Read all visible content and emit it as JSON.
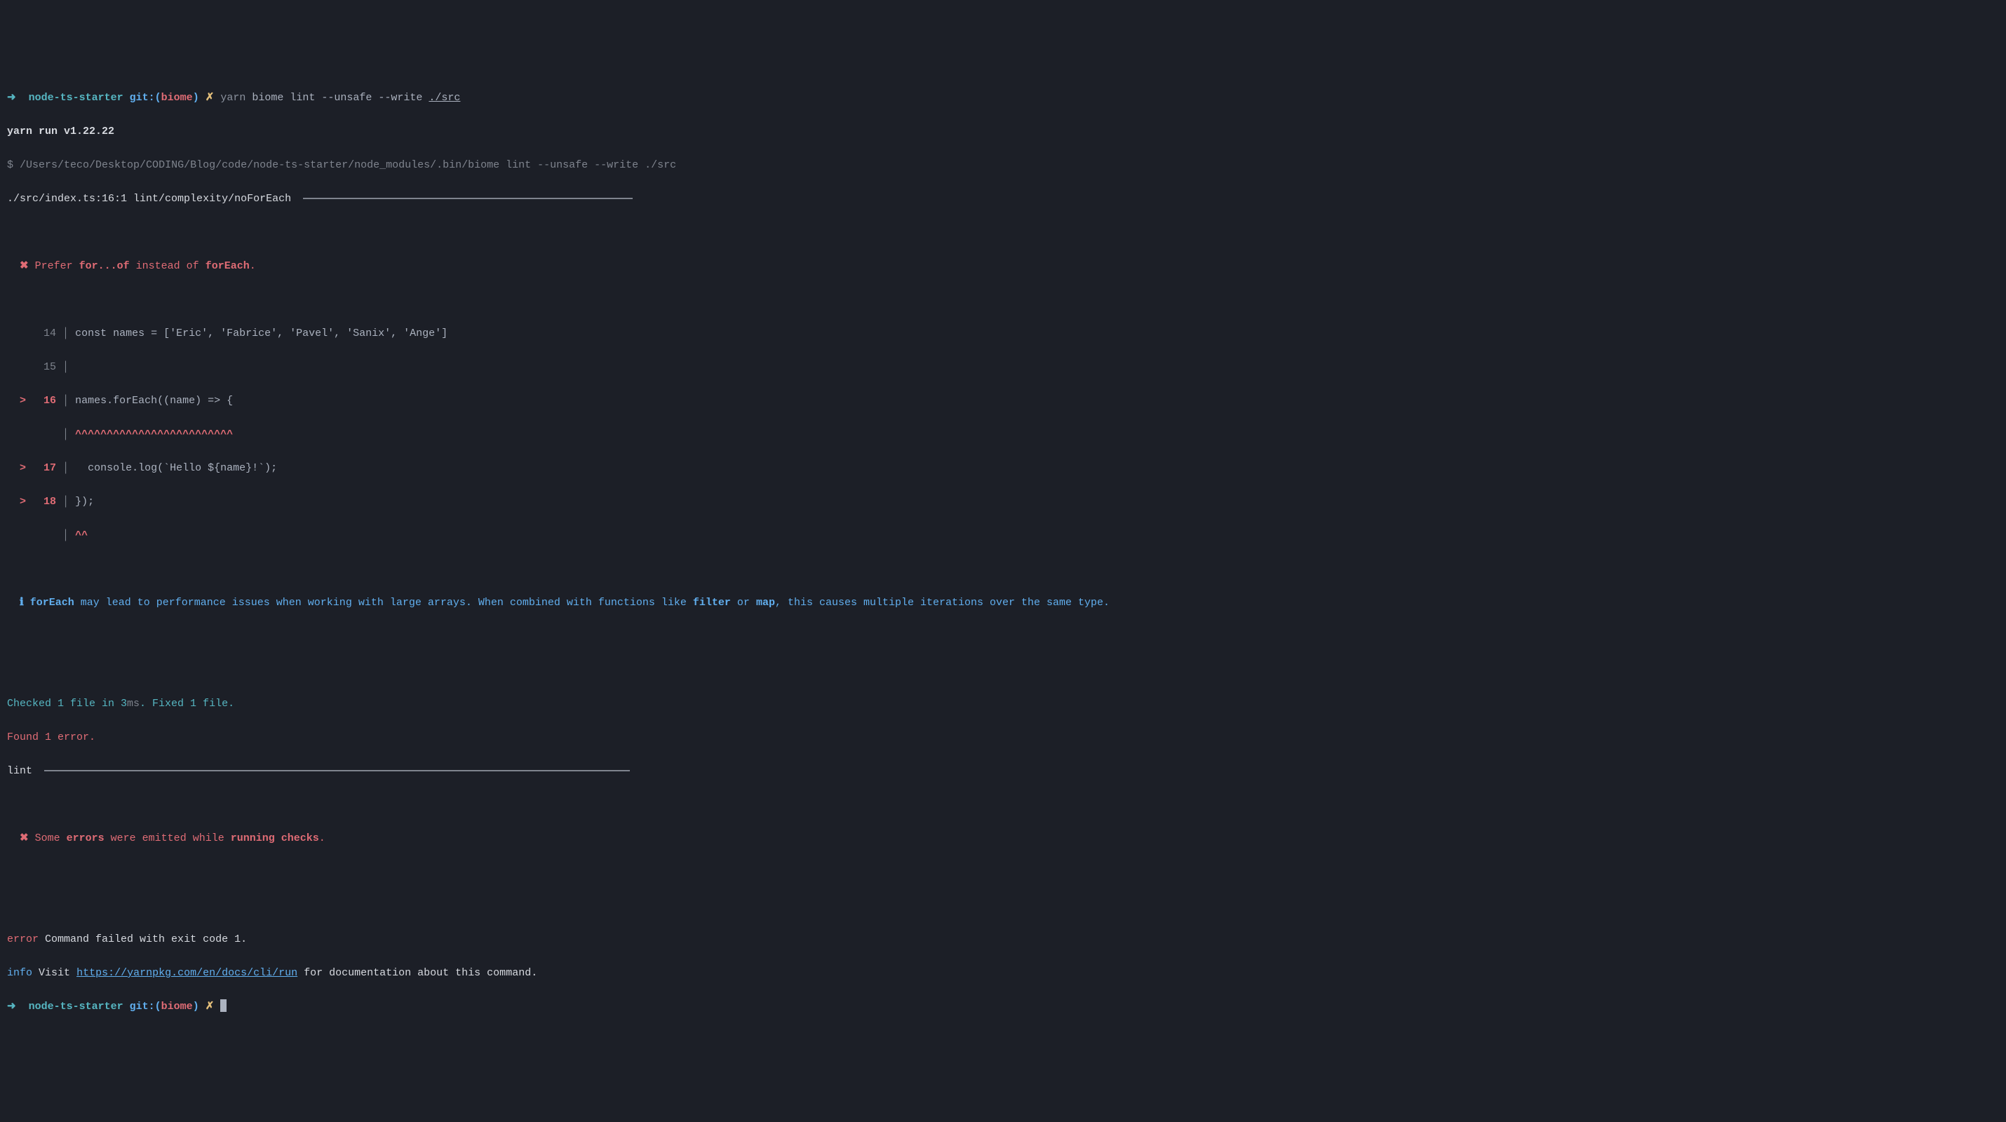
{
  "prompt1": {
    "arrow": "➜",
    "dir": "node-ts-starter",
    "git": "git:",
    "paren_open": "(",
    "branch": "biome",
    "paren_close": ")",
    "dirty": "✗",
    "cmd_yarn": "yarn",
    "cmd_rest": "biome lint --unsafe --write",
    "cmd_path": "./src"
  },
  "yarn_run": "yarn run v1.22.22",
  "exec_line": {
    "dollar": "$",
    "path": "/Users/teco/Desktop/CODING/Blog/code/node-ts-starter/node_modules/.bin/biome lint --unsafe --write ./src"
  },
  "diagnostic": {
    "location": "./src/index.ts:16:1",
    "rule": "lint/complexity/noForEach"
  },
  "advice": {
    "x": "✖",
    "pre": "Prefer",
    "kw1": "for...of",
    "mid": "instead of",
    "kw2": "forEach",
    "dot": "."
  },
  "code": {
    "l14": {
      "n": "14",
      "src": "const names = ['Eric', 'Fabrice', 'Pavel', 'Sanix', 'Ange']"
    },
    "l15": {
      "n": "15",
      "src": ""
    },
    "l16": {
      "mark": ">",
      "n": "16",
      "src": "names.forEach((name) => {"
    },
    "l16c": {
      "caret": "^^^^^^^^^^^^^^^^^^^^^^^^^"
    },
    "l17": {
      "mark": ">",
      "n": "17",
      "src": "  console.log(`Hello ${name}!`);"
    },
    "l18": {
      "mark": ">",
      "n": "18",
      "src": "});"
    },
    "l18c": {
      "caret": "^^"
    }
  },
  "info": {
    "i": "ℹ",
    "kw1": "forEach",
    "text1": " may lead to performance issues when working with large arrays. When combined with functions like ",
    "kw2": "filter",
    "text2": " or ",
    "kw3": "map",
    "text3": ", this causes multiple iterations over the same type."
  },
  "summary": {
    "checked_pre": "Checked 1 file in 3",
    "ms": "ms",
    "checked_post": ". Fixed 1 file.",
    "found_errors": "Found 1 error.",
    "lint_label": "lint"
  },
  "emitted": {
    "x": "✖",
    "pre": "Some",
    "kw1": "errors",
    "mid": "were emitted while",
    "kw2": "running checks",
    "dot": "."
  },
  "footer": {
    "error_label": "error",
    "error_text": "Command failed with exit code 1.",
    "info_label": "info",
    "info_text1": "Visit",
    "info_link": "https://yarnpkg.com/en/docs/cli/run",
    "info_text2": "for documentation about this command."
  },
  "prompt2": {
    "arrow": "➜",
    "dir": "node-ts-starter",
    "git": "git:",
    "paren_open": "(",
    "branch": "biome",
    "paren_close": ")",
    "dirty": "✗"
  }
}
